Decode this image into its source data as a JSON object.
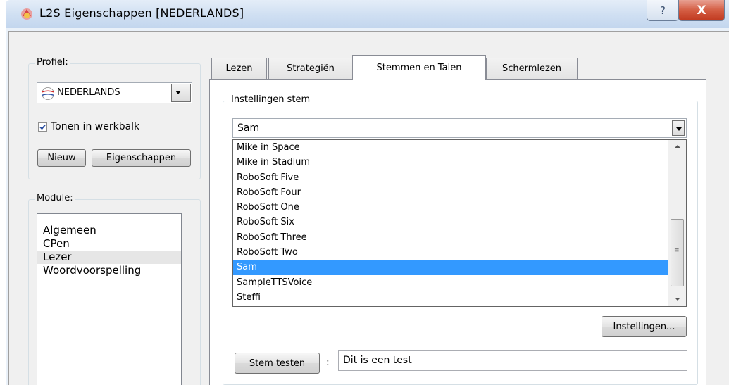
{
  "window": {
    "title": "L2S Eigenschappen [NEDERLANDS]",
    "help_glyph": "?",
    "close_glyph": "X"
  },
  "profile": {
    "legend": "Profiel:",
    "selected": "NEDERLANDS",
    "show_toolbar_label": "Tonen in werkbalk",
    "show_toolbar_checked": true,
    "new_button": "Nieuw",
    "properties_button": "Eigenschappen"
  },
  "module": {
    "legend": "Module:",
    "items": [
      "Algemeen",
      "CPen",
      "Lezer",
      "Woordvoorspelling"
    ],
    "selected": "Lezer"
  },
  "tabs": [
    "Lezen",
    "Strategiën",
    "Stemmen en Talen",
    "Schermlezen"
  ],
  "active_tab": "Stemmen en Talen",
  "voice": {
    "legend": "Instellingen stem",
    "selected": "Sam",
    "options": [
      "Mike in Space",
      "Mike in Stadium",
      "RoboSoft Five",
      "RoboSoft Four",
      "RoboSoft One",
      "RoboSoft Six",
      "RoboSoft Three",
      "RoboSoft Two",
      "Sam",
      "SampleTTSVoice",
      "Steffi"
    ],
    "settings_button": "Instellingen...",
    "test_button": "Stem testen",
    "test_separator": ":",
    "test_text": "Dit is een test"
  },
  "colors": {
    "selection": "#3399ff",
    "close_button": "#c0391f"
  }
}
